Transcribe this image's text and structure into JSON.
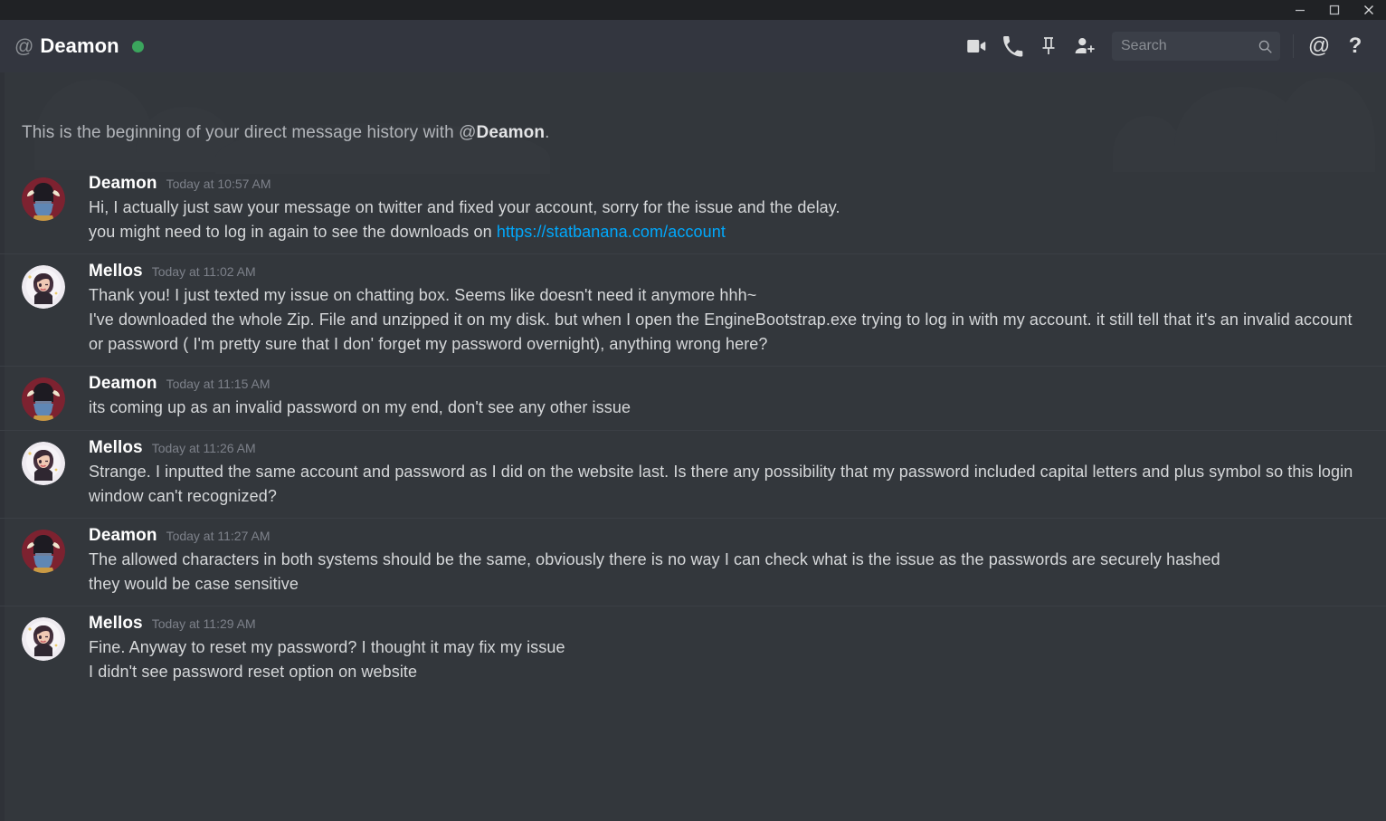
{
  "window": {
    "controls": [
      {
        "name": "minimize",
        "label": "—"
      },
      {
        "name": "maximize",
        "label": "☐"
      },
      {
        "name": "close",
        "label": "✕"
      }
    ]
  },
  "header": {
    "at_symbol": "@",
    "dm_name": "Deamon",
    "status": "online",
    "status_color": "#3ba55d",
    "icons": [
      {
        "name": "video-call-icon",
        "title": "Start Video Call"
      },
      {
        "name": "voice-call-icon",
        "title": "Start Voice Call"
      },
      {
        "name": "pin-icon",
        "title": "Pinned Messages"
      },
      {
        "name": "add-friend-icon",
        "title": "Add Friends to DM"
      }
    ],
    "search": {
      "placeholder": "Search",
      "value": "",
      "icon": "search-icon"
    },
    "mentions_icon": "@",
    "help_icon": "?"
  },
  "main": {
    "intro_prefix": "This is the beginning of your direct message history with @",
    "intro_name": "Deamon",
    "intro_suffix": ".",
    "link_color": "#00a8fc",
    "messages": [
      {
        "author": "Deamon",
        "avatar": "deamon",
        "timestamp": "Today at 10:57 AM",
        "lines": [
          {
            "text": "Hi, I actually just saw your message on twitter and fixed your account, sorry for the issue and the delay."
          },
          {
            "text": "you might need to log in again to see the downloads on ",
            "link": "https://statbanana.com/account"
          }
        ]
      },
      {
        "author": "Mellos",
        "avatar": "mellos",
        "timestamp": "Today at 11:02 AM",
        "lines": [
          {
            "text": "Thank you!  I just texted my issue on chatting box. Seems like doesn't need it anymore  hhh~"
          },
          {
            "text": "I've downloaded the whole Zip. File and  unzipped it on  my disk. but when I open the EngineBootstrap.exe trying to log in with my account. it still tell that it's an invalid account or password ( I'm pretty sure that I don' forget my password overnight), anything wrong here?"
          }
        ]
      },
      {
        "author": "Deamon",
        "avatar": "deamon",
        "timestamp": "Today at 11:15 AM",
        "lines": [
          {
            "text": "its coming up as an invalid password on my end, don't see any other issue"
          }
        ]
      },
      {
        "author": "Mellos",
        "avatar": "mellos",
        "timestamp": "Today at 11:26 AM",
        "lines": [
          {
            "text": "Strange. I inputted the same account and password as I did on the website last. Is there any possibility that my password included capital letters and plus symbol so this login window can't recognized?"
          }
        ]
      },
      {
        "author": "Deamon",
        "avatar": "deamon",
        "timestamp": "Today at 11:27 AM",
        "lines": [
          {
            "text": "The allowed characters in both systems should be the same, obviously there is no way I can check what is the issue as the passwords are securely hashed"
          },
          {
            "text": "they would be case sensitive"
          }
        ]
      },
      {
        "author": "Mellos",
        "avatar": "mellos",
        "timestamp": "Today at 11:29 AM",
        "lines": [
          {
            "text": "Fine. Anyway to reset my password? I thought it may fix my issue"
          },
          {
            "text": "I didn't see password reset option on website"
          }
        ]
      }
    ]
  }
}
